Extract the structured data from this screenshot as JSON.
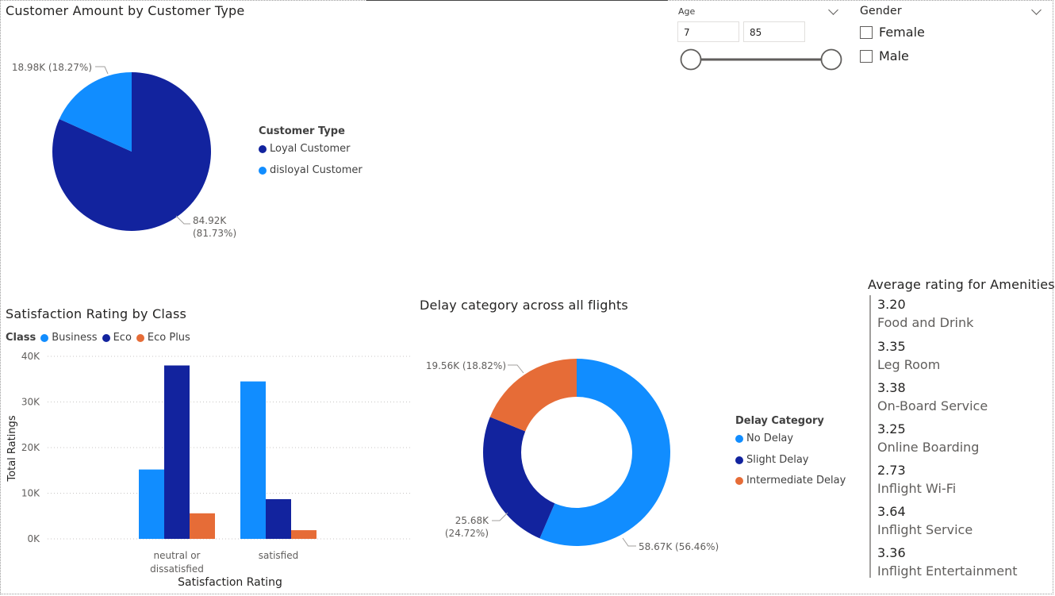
{
  "colors": {
    "dark_blue": "#12239E",
    "light_blue": "#118DFF",
    "orange": "#E66C37",
    "text": "#252423",
    "subtext": "#605e5c"
  },
  "slicers": {
    "age": {
      "title": "Age",
      "min_value": "7",
      "max_value": "85"
    },
    "gender": {
      "title": "Gender",
      "options": [
        "Female",
        "Male"
      ]
    }
  },
  "amenities": {
    "title": "Average rating for Amenities",
    "items": [
      {
        "value": "3.20",
        "name": "Food and Drink"
      },
      {
        "value": "3.35",
        "name": "Leg Room"
      },
      {
        "value": "3.38",
        "name": "On-Board Service"
      },
      {
        "value": "3.25",
        "name": "Online Boarding"
      },
      {
        "value": "2.73",
        "name": "Inflight Wi-Fi"
      },
      {
        "value": "3.64",
        "name": "Inflight Service"
      },
      {
        "value": "3.36",
        "name": "Inflight Entertainment"
      }
    ]
  },
  "chart_data": [
    {
      "type": "pie",
      "title": "Customer Amount by Customer Type",
      "legend_title": "Customer Type",
      "legend_position": "right",
      "categories": [
        "Loyal Customer",
        "disloyal Customer"
      ],
      "values": [
        84920,
        18980
      ],
      "data_labels": [
        "84.92K (81.73%)",
        "18.98K (18.27%)"
      ],
      "label_parts": [
        [
          "84.92K",
          "(81.73%)"
        ],
        [
          "18.98K (18.27%)"
        ]
      ],
      "colors": [
        "#12239E",
        "#118DFF"
      ]
    },
    {
      "type": "bar",
      "title": "Satisfaction Rating by Class",
      "legend_title": "Class",
      "legend_position": "top-left",
      "categories": [
        "neutral or dissatisfied",
        "satisfied"
      ],
      "category_lines": [
        [
          "neutral or",
          "dissatisfied"
        ],
        [
          "satisfied"
        ]
      ],
      "series": [
        {
          "name": "Business",
          "values": [
            15200,
            34500
          ],
          "color": "#118DFF"
        },
        {
          "name": "Eco",
          "values": [
            38000,
            8700
          ],
          "color": "#12239E"
        },
        {
          "name": "Eco Plus",
          "values": [
            5600,
            1900
          ],
          "color": "#E66C37"
        }
      ],
      "xlabel": "Satisfaction Rating",
      "ylabel": "Total Ratings",
      "ylim": [
        0,
        40000
      ],
      "y_ticks": [
        0,
        10000,
        20000,
        30000,
        40000
      ],
      "y_tick_labels": [
        "0K",
        "10K",
        "20K",
        "30K",
        "40K"
      ],
      "grid": true
    },
    {
      "type": "pie",
      "variant": "donut",
      "title": "Delay category across all flights",
      "legend_title": "Delay Category",
      "legend_position": "right",
      "categories": [
        "No Delay",
        "Slight Delay",
        "Intermediate Delay"
      ],
      "values": [
        58670,
        25680,
        19560
      ],
      "data_labels": [
        "58.67K (56.46%)",
        "25.68K (24.72%)",
        "19.56K (18.82%)"
      ],
      "label_parts": [
        [
          "58.67K (56.46%)"
        ],
        [
          "25.68K",
          "(24.72%)"
        ],
        [
          "19.56K (18.82%)"
        ]
      ],
      "colors": [
        "#118DFF",
        "#12239E",
        "#E66C37"
      ]
    }
  ]
}
